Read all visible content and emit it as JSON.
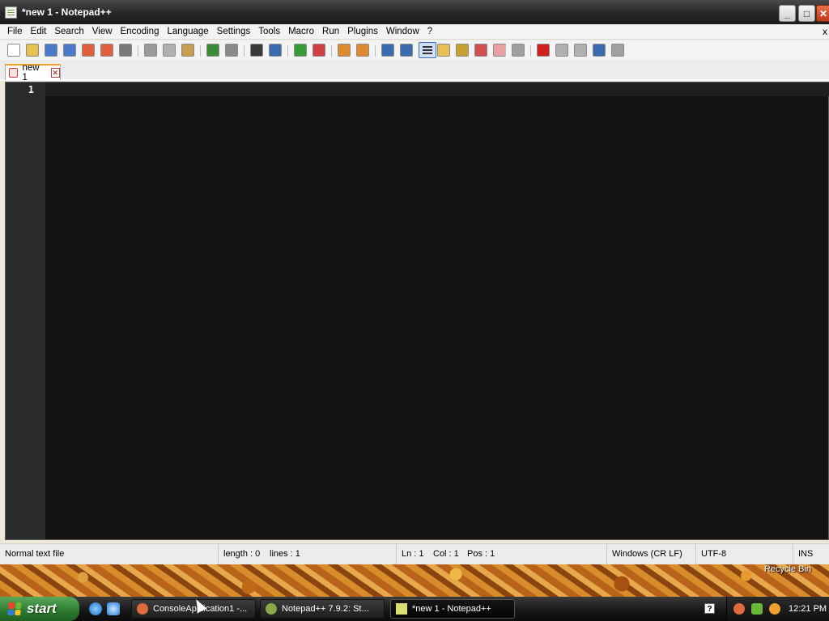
{
  "window": {
    "title": "*new 1 - Notepad++",
    "minimize_glyph": "_",
    "maximize_glyph": "□",
    "close_glyph": "✕"
  },
  "menu": {
    "items": [
      "File",
      "Edit",
      "Search",
      "View",
      "Encoding",
      "Language",
      "Settings",
      "Tools",
      "Macro",
      "Run",
      "Plugins",
      "Window",
      "?"
    ],
    "close_glyph": "x"
  },
  "toolbar": {
    "buttons": [
      {
        "name": "new-file-icon",
        "color": "#ffffff"
      },
      {
        "name": "open-file-icon",
        "color": "#e8c050"
      },
      {
        "name": "save-icon",
        "color": "#4a7ac8"
      },
      {
        "name": "save-all-icon",
        "color": "#4a7ac8"
      },
      {
        "name": "close-icon",
        "color": "#e06040"
      },
      {
        "name": "close-all-icon",
        "color": "#e06040"
      },
      {
        "name": "print-icon",
        "color": "#7a7a7a"
      },
      {
        "name": "cut-icon",
        "color": "#9a9a9a"
      },
      {
        "name": "copy-icon",
        "color": "#b0b0b0"
      },
      {
        "name": "paste-icon",
        "color": "#c8a050"
      },
      {
        "name": "undo-icon",
        "color": "#3a8a3a"
      },
      {
        "name": "redo-icon",
        "color": "#8a8a8a"
      },
      {
        "name": "find-icon",
        "color": "#3a3a3a"
      },
      {
        "name": "replace-icon",
        "color": "#3a6ab0"
      },
      {
        "name": "zoom-in-icon",
        "color": "#3a9a3a"
      },
      {
        "name": "zoom-out-icon",
        "color": "#d04040"
      },
      {
        "name": "sync-vertical-icon",
        "color": "#e08a30"
      },
      {
        "name": "sync-horizontal-icon",
        "color": "#e08a30"
      },
      {
        "name": "word-wrap-icon",
        "color": "#3a6ab0"
      },
      {
        "name": "show-all-chars-icon",
        "color": "#3a6ab0"
      },
      {
        "name": "indent-guide-icon",
        "color": "#cfe0f6"
      },
      {
        "name": "doc-map-icon",
        "color": "#e8c050"
      },
      {
        "name": "function-list-icon",
        "color": "#c8a030"
      },
      {
        "name": "folder-as-workspace-icon",
        "color": "#d05050"
      },
      {
        "name": "monitoring-icon",
        "color": "#e8a0a0"
      },
      {
        "name": "macro-circle-icon",
        "color": "#a0a0a0"
      },
      {
        "name": "record-macro-icon",
        "color": "#d02020"
      },
      {
        "name": "stop-recording-icon",
        "color": "#b0b0b0"
      },
      {
        "name": "playback-macro-icon",
        "color": "#b0b0b0"
      },
      {
        "name": "run-macro-multiple-icon",
        "color": "#3a6ab0"
      },
      {
        "name": "save-macro-icon",
        "color": "#a0a0a0"
      }
    ]
  },
  "tabs": [
    {
      "label": "new 1",
      "close_glyph": "✕"
    }
  ],
  "editor": {
    "line_numbers": [
      "1"
    ],
    "background": "#121212",
    "gutter": "#2a2b2d"
  },
  "status": {
    "file_type": "Normal text file",
    "length": "length : 0",
    "lines": "lines : 1",
    "ln": "Ln : 1",
    "col": "Col : 1",
    "pos": "Pos : 1",
    "eol": "Windows (CR LF)",
    "encoding": "UTF-8",
    "mode": "INS"
  },
  "desktop": {
    "recycle_label": "Recycle Bin"
  },
  "taskbar": {
    "start_label": "start",
    "tasks": [
      {
        "label": "ConsoleApplication1 -...",
        "icon_color": "#e06a40"
      },
      {
        "label": "Notepad++ 7.9.2: St...",
        "icon_color": "#8aa84a"
      },
      {
        "label": "*new 1 - Notepad++",
        "icon_color": "#d8e070"
      }
    ],
    "help_glyph": "?",
    "clock": "12:21 PM"
  }
}
